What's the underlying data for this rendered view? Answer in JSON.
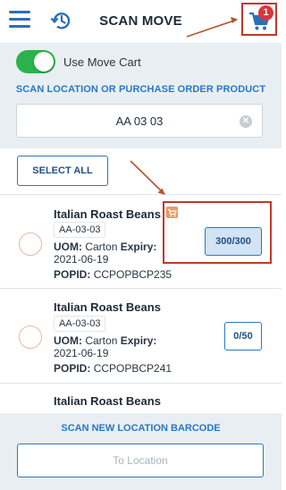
{
  "header": {
    "title": "SCAN MOVE",
    "cart_count": "1",
    "menu_icon": "hamburger-menu-icon",
    "history_icon": "history-icon",
    "cart_icon": "shopping-cart-icon"
  },
  "move_cart": {
    "label": "Use Move Cart",
    "enabled": true
  },
  "scan": {
    "label": "SCAN LOCATION OR PURCHASE ORDER PRODUCT",
    "value": "AA 03 03"
  },
  "select_all_label": "SELECT ALL",
  "items": [
    {
      "name": "Italian Roast Beans",
      "location": "AA-03-03",
      "uom_label": "UOM:",
      "uom": "Carton",
      "expiry_label": "Expiry:",
      "expiry": "2021-06-19",
      "popid_label": "POPID:",
      "popid": "CCPOPBCP235",
      "quantity": "300/300",
      "in_cart": true
    },
    {
      "name": "Italian Roast Beans",
      "location": "AA-03-03",
      "uom_label": "UOM:",
      "uom": "Carton",
      "expiry_label": "Expiry:",
      "expiry": "2021-06-19",
      "popid_label": "POPID:",
      "popid": "CCPOPBCP241",
      "quantity": "0/50",
      "in_cart": false
    },
    {
      "name": "Italian Roast Beans"
    }
  ],
  "footer": {
    "label": "SCAN NEW LOCATION BARCODE",
    "placeholder": "To Location"
  },
  "colors": {
    "accent": "#2a78c2",
    "toggle_on": "#29b34a",
    "badge": "#d9363e",
    "annotation": "#c0392b"
  }
}
